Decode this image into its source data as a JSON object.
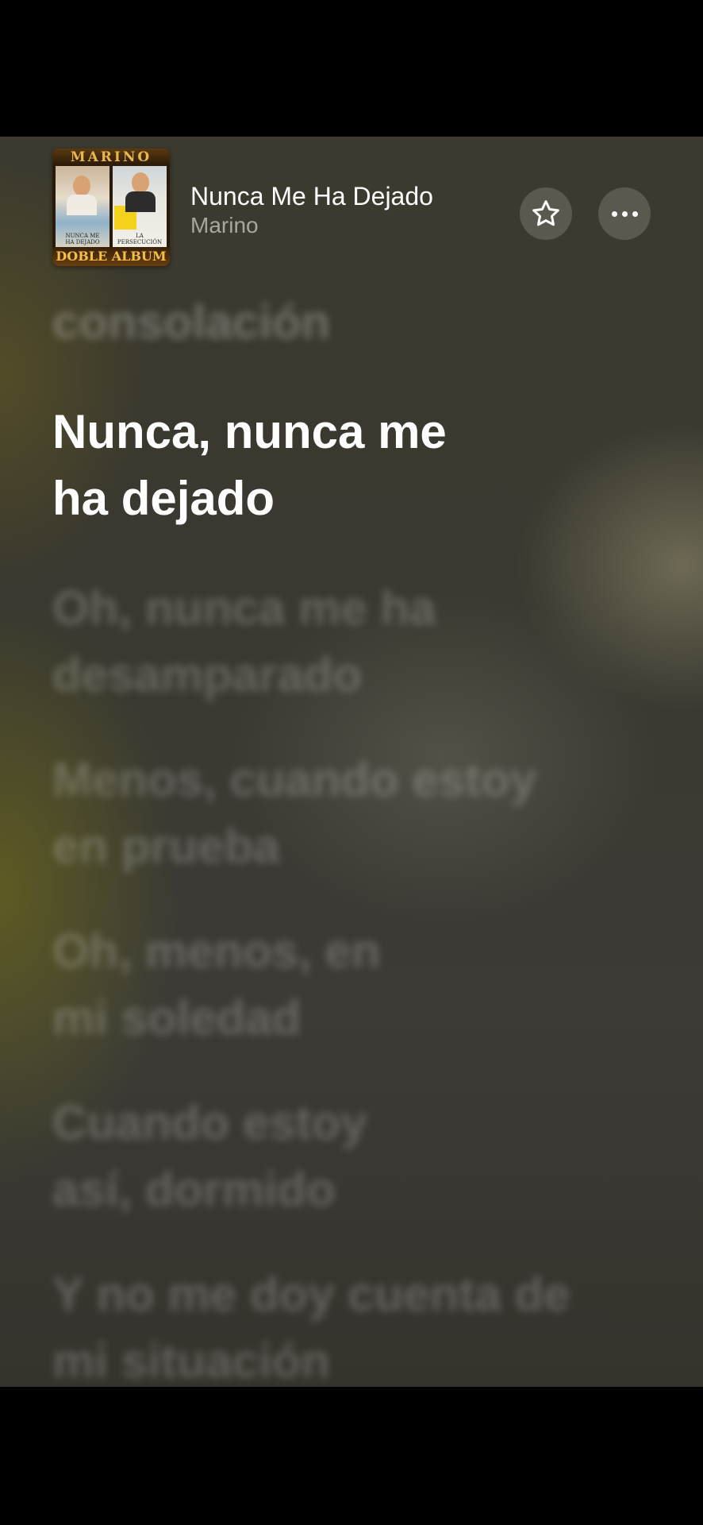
{
  "header": {
    "album_art": {
      "top_text": "MARINO",
      "left_caption_line1": "NUNCA ME",
      "left_caption_line2": "HA DEJADO",
      "right_caption_line1": "LA",
      "right_caption_line2": "PERSECUCIÓN",
      "bottom_text": "DOBLE ALBUM"
    },
    "track_title": "Nunca Me Ha Dejado",
    "artist": "Marino",
    "favorite_icon": "star-outline-icon",
    "more_icon": "ellipsis-icon"
  },
  "lyrics": {
    "previous_line": "consolación",
    "active_line1": "Nunca, nunca me",
    "active_line2": "ha dejado",
    "upcoming": [
      {
        "line1": "Oh, nunca me ha",
        "line2": "desamparado"
      },
      {
        "line1": "Menos, cuando estoy",
        "line2": "en prueba"
      },
      {
        "line1": "Oh, menos, en",
        "line2": "mi soledad"
      },
      {
        "line1": "Cuando estoy",
        "line2": "así, dormido"
      },
      {
        "line1": "Y no me doy cuenta de",
        "line2": "mi situación"
      }
    ]
  },
  "colors": {
    "active_text": "#ffffff",
    "dim_text": "rgba(255,255,255,0.22)",
    "button_bg": "rgba(255,255,255,0.16)"
  }
}
